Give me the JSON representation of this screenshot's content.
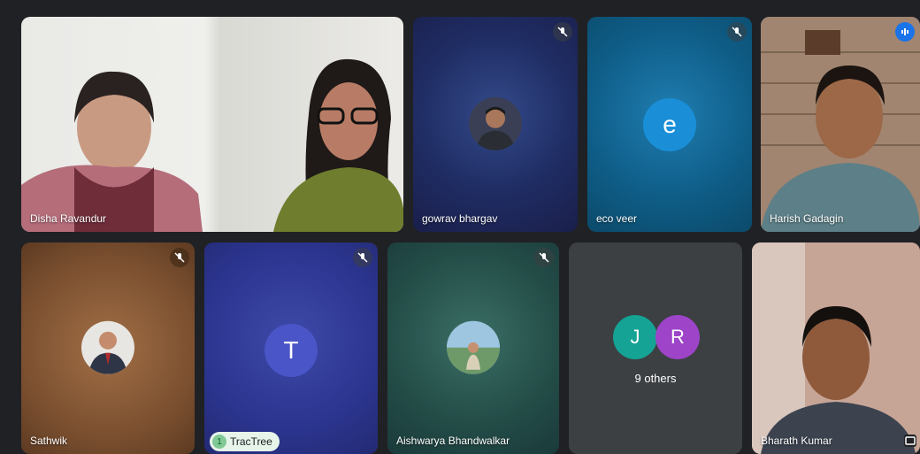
{
  "participants": [
    {
      "name": "Disha Ravandur"
    },
    {
      "name": "gowrav bhargav"
    },
    {
      "name": "eco veer",
      "initial": "e"
    },
    {
      "name": "Harish Gadagin"
    },
    {
      "name": "Sathwik"
    },
    {
      "name": "TracTree",
      "initial": "T",
      "badge": "1"
    },
    {
      "name": "Aishwarya Bhandwalkar"
    },
    {
      "name": "Bharath Kumar"
    }
  ],
  "others": {
    "initials": [
      "J",
      "R"
    ],
    "label": "9 others"
  },
  "icons": {
    "muted": "mic-off-icon",
    "speaking": "audio-level-icon",
    "present": "present-screen-icon"
  },
  "colors": {
    "background": "#202124",
    "eco_avatar": "#1a8fd8",
    "tractree_avatar": "#4a55c7",
    "j_avatar": "#14a394",
    "r_avatar": "#9d44c8",
    "speaking_border": "#8ab4f8"
  }
}
